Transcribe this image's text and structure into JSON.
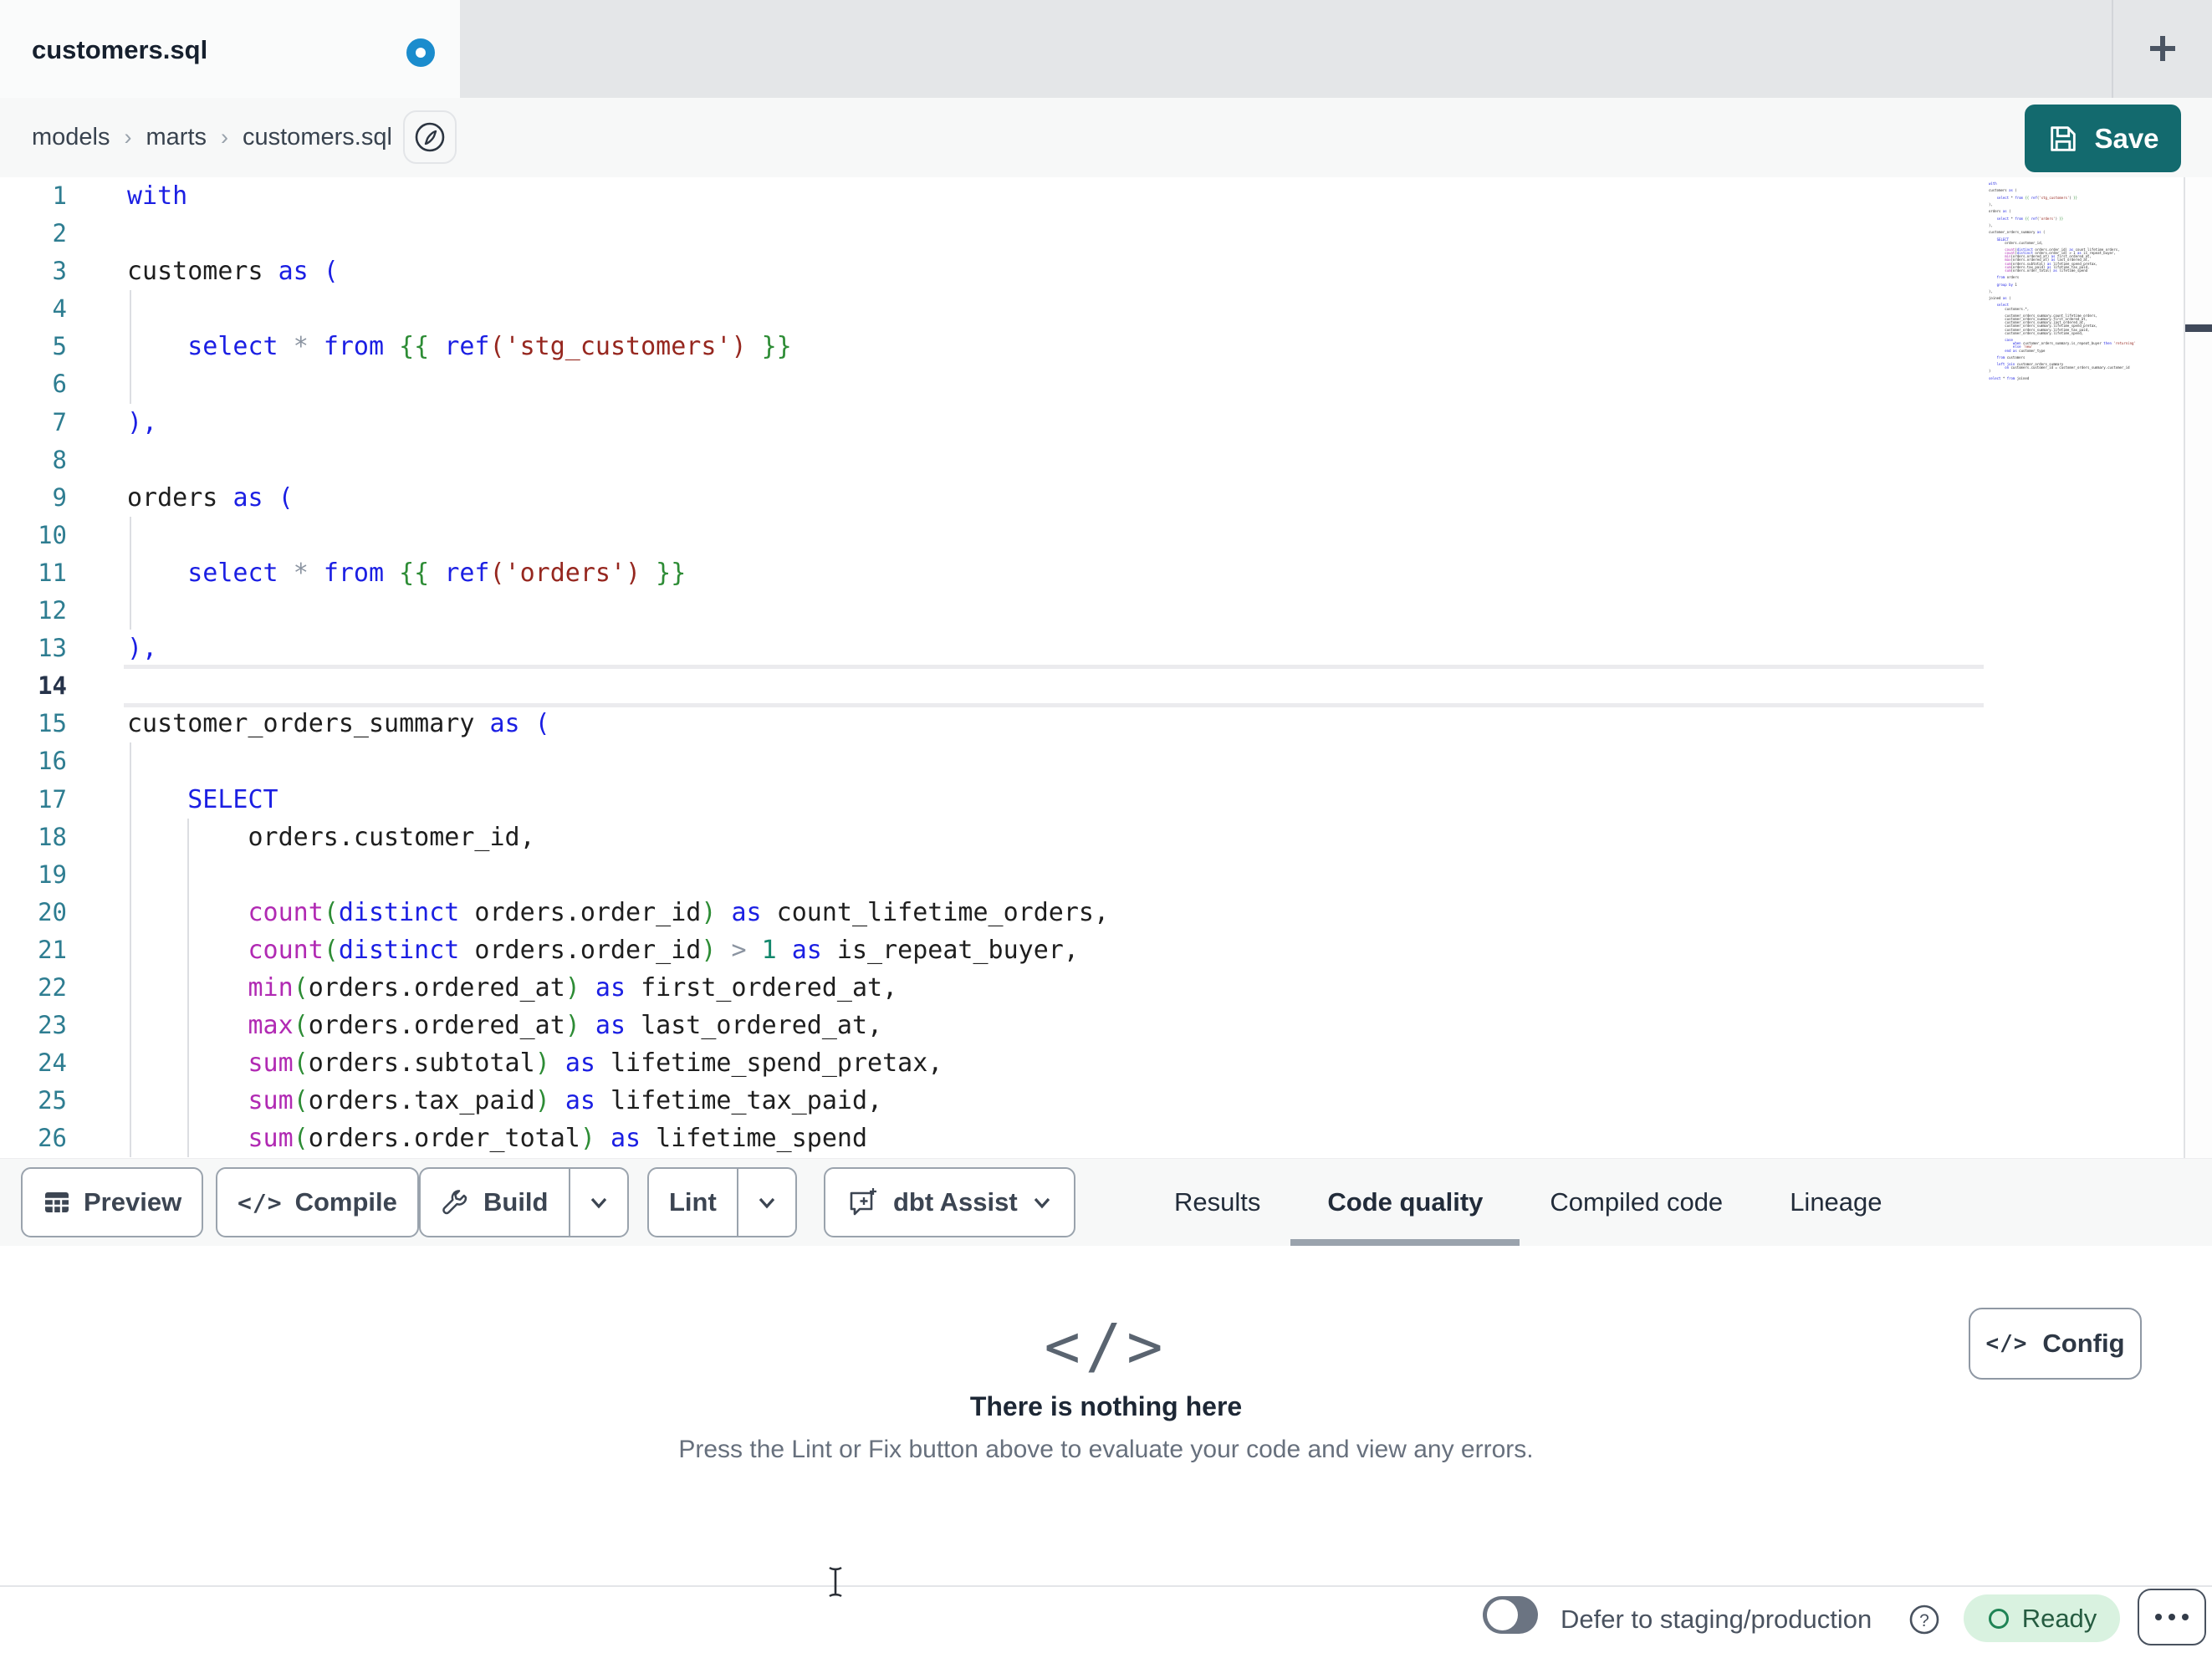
{
  "colors": {
    "accent_teal": "#136a6e",
    "unsaved_dot_blue": "#1b8ccd",
    "tab_bar_bg": "#e4e6e8",
    "ready_badge_bg": "#d9f2e0",
    "ready_badge_text": "#265c41",
    "active_tab_underline": "#9aa3ad",
    "syntax": {
      "keyword": "#1b1fe3",
      "identifier": "#1e1e1e",
      "function": "#b12ab3",
      "paren": "#2d8c35",
      "jinja": "#2d8c35",
      "string": "#96271f",
      "operator": "#8b94a1",
      "number": "#13876c",
      "line_number": "#2e7d91"
    }
  },
  "icons": {
    "new_tab": "plus-icon",
    "breadcrumb_action": "compass-icon",
    "save": "floppy-disk-icon",
    "preview": "table-icon",
    "compile": "code-icon",
    "build": "wrench-icon",
    "assist": "chat-sparkle-icon",
    "dropdown": "chevron-down-icon",
    "help": "question-circle-icon",
    "more": "ellipsis-icon",
    "ready": "circle-outline-icon",
    "code_glyph": "</>"
  },
  "tab_bar": {
    "tabs": [
      {
        "title": "customers.sql",
        "dirty": true
      }
    ]
  },
  "breadcrumb": {
    "items": [
      "models",
      "marts",
      "customers.sql"
    ],
    "separator": "›"
  },
  "save_button": {
    "label": "Save"
  },
  "editor": {
    "active_line": 14,
    "lines": [
      {
        "n": 1,
        "s": [
          [
            "kw",
            "with"
          ]
        ]
      },
      {
        "n": 2,
        "s": []
      },
      {
        "n": 3,
        "s": [
          [
            "id",
            "customers "
          ],
          [
            "kw",
            "as ("
          ]
        ]
      },
      {
        "n": 4,
        "s": [],
        "g": 1
      },
      {
        "n": 5,
        "s": [
          [
            "kw",
            "    select "
          ],
          [
            "op",
            "* "
          ],
          [
            "kw",
            "from "
          ],
          [
            "jj",
            "{{ "
          ],
          [
            "kw",
            "ref"
          ],
          [
            "str",
            "('stg_customers')"
          ],
          [
            "jj",
            " }}"
          ]
        ],
        "g": 1
      },
      {
        "n": 6,
        "s": [],
        "g": 1
      },
      {
        "n": 7,
        "s": [
          [
            "kw",
            "),"
          ]
        ]
      },
      {
        "n": 8,
        "s": []
      },
      {
        "n": 9,
        "s": [
          [
            "id",
            "orders "
          ],
          [
            "kw",
            "as ("
          ]
        ]
      },
      {
        "n": 10,
        "s": [],
        "g": 1
      },
      {
        "n": 11,
        "s": [
          [
            "kw",
            "    select "
          ],
          [
            "op",
            "* "
          ],
          [
            "kw",
            "from "
          ],
          [
            "jj",
            "{{ "
          ],
          [
            "kw",
            "ref"
          ],
          [
            "str",
            "('orders')"
          ],
          [
            "jj",
            " }}"
          ]
        ],
        "g": 1
      },
      {
        "n": 12,
        "s": [],
        "g": 1
      },
      {
        "n": 13,
        "s": [
          [
            "kw",
            "),"
          ]
        ]
      },
      {
        "n": 14,
        "s": []
      },
      {
        "n": 15,
        "s": [
          [
            "id",
            "customer_orders_summary "
          ],
          [
            "kw",
            "as ("
          ]
        ]
      },
      {
        "n": 16,
        "s": [],
        "g": 1
      },
      {
        "n": 17,
        "s": [
          [
            "kw",
            "    SELECT"
          ]
        ],
        "g": 1
      },
      {
        "n": 18,
        "s": [
          [
            "id",
            "        orders.customer_id,"
          ]
        ],
        "g": 2
      },
      {
        "n": 19,
        "s": [],
        "g": 2
      },
      {
        "n": 20,
        "s": [
          [
            "id",
            "        "
          ],
          [
            "fn",
            "count"
          ],
          [
            "pg",
            "("
          ],
          [
            "kw",
            "distinct"
          ],
          [
            "id",
            " orders.order_id"
          ],
          [
            "pg",
            ")"
          ],
          [
            "id",
            " "
          ],
          [
            "kw",
            "as"
          ],
          [
            "id",
            " count_lifetime_orders,"
          ]
        ],
        "g": 2
      },
      {
        "n": 21,
        "s": [
          [
            "id",
            "        "
          ],
          [
            "fn",
            "count"
          ],
          [
            "pg",
            "("
          ],
          [
            "kw",
            "distinct"
          ],
          [
            "id",
            " orders.order_id"
          ],
          [
            "pg",
            ")"
          ],
          [
            "id",
            " "
          ],
          [
            "op",
            "&gt;"
          ],
          [
            "id",
            " "
          ],
          [
            "num",
            "1"
          ],
          [
            "id",
            " "
          ],
          [
            "kw",
            "as"
          ],
          [
            "id",
            " is_repeat_buyer,"
          ]
        ],
        "g": 2
      },
      {
        "n": 22,
        "s": [
          [
            "id",
            "        "
          ],
          [
            "fn",
            "min"
          ],
          [
            "pg",
            "("
          ],
          [
            "id",
            "orders.ordered_at"
          ],
          [
            "pg",
            ")"
          ],
          [
            "id",
            " "
          ],
          [
            "kw",
            "as"
          ],
          [
            "id",
            " first_ordered_at,"
          ]
        ],
        "g": 2
      },
      {
        "n": 23,
        "s": [
          [
            "id",
            "        "
          ],
          [
            "fn",
            "max"
          ],
          [
            "pg",
            "("
          ],
          [
            "id",
            "orders.ordered_at"
          ],
          [
            "pg",
            ")"
          ],
          [
            "id",
            " "
          ],
          [
            "kw",
            "as"
          ],
          [
            "id",
            " last_ordered_at,"
          ]
        ],
        "g": 2
      },
      {
        "n": 24,
        "s": [
          [
            "id",
            "        "
          ],
          [
            "fn",
            "sum"
          ],
          [
            "pg",
            "("
          ],
          [
            "id",
            "orders.subtotal"
          ],
          [
            "pg",
            ")"
          ],
          [
            "id",
            " "
          ],
          [
            "kw",
            "as"
          ],
          [
            "id",
            " lifetime_spend_pretax,"
          ]
        ],
        "g": 2
      },
      {
        "n": 25,
        "s": [
          [
            "id",
            "        "
          ],
          [
            "fn",
            "sum"
          ],
          [
            "pg",
            "("
          ],
          [
            "id",
            "orders.tax_paid"
          ],
          [
            "pg",
            ")"
          ],
          [
            "id",
            " "
          ],
          [
            "kw",
            "as"
          ],
          [
            "id",
            " lifetime_tax_paid,"
          ]
        ],
        "g": 2
      },
      {
        "n": 26,
        "s": [
          [
            "id",
            "        "
          ],
          [
            "fn",
            "sum"
          ],
          [
            "pg",
            "("
          ],
          [
            "id",
            "orders.order_total"
          ],
          [
            "pg",
            ")"
          ],
          [
            "id",
            " "
          ],
          [
            "kw",
            "as"
          ],
          [
            "id",
            " lifetime_spend"
          ]
        ],
        "g": 2
      }
    ]
  },
  "minimap": {
    "lines": [
      "with",
      "",
      "customers as (",
      "",
      "    select * from {{ ref('stg_customers') }}",
      "",
      "),",
      "",
      "orders as (",
      "",
      "    select * from {{ ref('orders') }}",
      "",
      "),",
      "",
      "customer_orders_summary as (",
      "",
      "    SELECT",
      "        orders.customer_id,",
      "",
      "        count(distinct orders.order_id) as count_lifetime_orders,",
      "        count(distinct orders.order_id) > 1 as is_repeat_buyer,",
      "        min(orders.ordered_at) as first_ordered_at,",
      "        max(orders.ordered_at) as last_ordered_at,",
      "        sum(orders.subtotal) as lifetime_spend_pretax,",
      "        sum(orders.tax_paid) as lifetime_tax_paid,",
      "        sum(orders.order_total) as lifetime_spend",
      "",
      "    from orders",
      "",
      "    group by 1",
      "",
      "),",
      "",
      "joined as (",
      "",
      "    select",
      "        customers.*,",
      "",
      "        customer_orders_summary.count_lifetime_orders,",
      "        customer_orders_summary.first_ordered_at,",
      "        customer_orders_summary.last_ordered_at,",
      "        customer_orders_summary.lifetime_spend_pretax,",
      "        customer_orders_summary.lifetime_tax_paid,",
      "        customer_orders_summary.lifetime_spend,",
      "",
      "        case",
      "            when customer_orders_summary.is_repeat_buyer then 'returning'",
      "            else 'new'",
      "        end as customer_type",
      "",
      "    from customers",
      "",
      "    left join customer_orders_summary",
      "        on customers.customer_id = customer_orders_summary.customer_id",
      ")",
      "",
      "select * from joined"
    ]
  },
  "toolbar": {
    "preview": "Preview",
    "compile": "Compile",
    "build": "Build",
    "lint": "Lint",
    "assist": "dbt Assist"
  },
  "result_tabs": [
    {
      "label": "Results",
      "active": false
    },
    {
      "label": "Code quality",
      "active": true
    },
    {
      "label": "Compiled code",
      "active": false
    },
    {
      "label": "Lineage",
      "active": false
    }
  ],
  "panel": {
    "empty_title": "There is nothing here",
    "empty_subtitle": "Press the Lint or Fix button above to evaluate your code and view any errors.",
    "config_label": "Config"
  },
  "status_bar": {
    "defer_label": "Defer to staging/production",
    "ready_label": "Ready"
  }
}
